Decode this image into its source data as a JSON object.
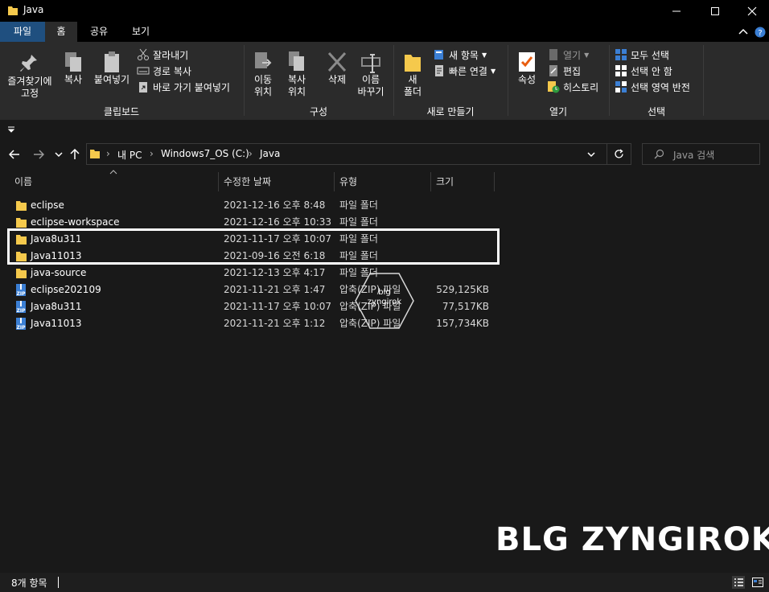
{
  "window": {
    "title": "Java",
    "controls": [
      "minimize-icon",
      "maximize-icon",
      "close-icon"
    ]
  },
  "ribbon_tabs": [
    "파일",
    "홈",
    "공유",
    "보기"
  ],
  "ribbon": {
    "clipboard": {
      "pin_label": "즐겨찾기에\n고정",
      "copy": "복사",
      "paste": "붙여넣기",
      "cut": "잘라내기",
      "copy_path": "경로 복사",
      "paste_shortcut": "바로 가기 붙여넣기",
      "group": "클립보드"
    },
    "organize": {
      "move_to": "이동\n위치",
      "copy_to": "복사\n위치",
      "delete": "삭제",
      "rename": "이름\n바꾸기",
      "group": "구성"
    },
    "new": {
      "new_folder": "새\n폴더",
      "new_item": "새 항목",
      "easy_access": "빠른 연결",
      "group": "새로 만들기"
    },
    "open": {
      "properties": "속성",
      "open": "열기",
      "edit": "편집",
      "history": "히스토리",
      "group": "열기"
    },
    "select": {
      "select_all": "모두 선택",
      "select_none": "선택 안 함",
      "invert": "선택 영역 반전",
      "group": "선택"
    }
  },
  "address": {
    "crumbs": [
      "내 PC",
      "Windows7_OS (C:)",
      "Java"
    ],
    "search_placeholder": "Java 검색"
  },
  "columns": {
    "name": "이름",
    "date": "수정한 날짜",
    "type": "유형",
    "size": "크기"
  },
  "files": [
    {
      "name": "eclipse",
      "date": "2021-12-16 오후 8:48",
      "type": "파일 폴더",
      "size": "",
      "icon": "folder-icon"
    },
    {
      "name": "eclipse-workspace",
      "date": "2021-12-16 오후 10:33",
      "type": "파일 폴더",
      "size": "",
      "icon": "folder-icon"
    },
    {
      "name": "Java8u311",
      "date": "2021-11-17 오후 10:07",
      "type": "파일 폴더",
      "size": "",
      "icon": "folder-icon"
    },
    {
      "name": "Java11013",
      "date": "2021-09-16 오전 6:18",
      "type": "파일 폴더",
      "size": "",
      "icon": "folder-icon"
    },
    {
      "name": "java-source",
      "date": "2021-12-13 오후 4:17",
      "type": "파일 폴더",
      "size": "",
      "icon": "folder-icon"
    },
    {
      "name": "eclipse202109",
      "date": "2021-11-21 오후 1:47",
      "type": "압축(ZIP) 파일",
      "size": "529,125KB",
      "icon": "zip-icon"
    },
    {
      "name": "Java8u311",
      "date": "2021-11-17 오후 10:07",
      "type": "압축(ZIP) 파일",
      "size": "77,517KB",
      "icon": "zip-icon"
    },
    {
      "name": "Java11013",
      "date": "2021-11-21 오후 1:12",
      "type": "압축(ZIP) 파일",
      "size": "157,734KB",
      "icon": "zip-icon"
    }
  ],
  "watermark": {
    "badge_line1": "blg",
    "badge_line2": "zyngirok",
    "text": "BLG ZYNGIROK"
  },
  "status": {
    "item_count": "8개 항목"
  },
  "colors": {
    "background": "#191919",
    "ribbon": "#2b2b2b",
    "file_tab": "#1f4f7f",
    "folder": "#f5c94c",
    "zip": "#3b7fd4"
  }
}
